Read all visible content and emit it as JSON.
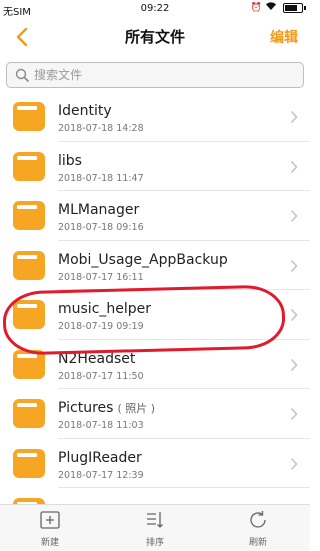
{
  "status_bar": {
    "carrier": "无SIM",
    "time": "09:22",
    "battery_label": ""
  },
  "nav": {
    "title": "所有文件",
    "edit_label": "编辑"
  },
  "search": {
    "placeholder": "搜索文件"
  },
  "files": [
    {
      "name": "Identity",
      "tag": "",
      "date": "2018-07-18 14:28"
    },
    {
      "name": "libs",
      "tag": "",
      "date": "2018-07-18 11:47"
    },
    {
      "name": "MLManager",
      "tag": "",
      "date": "2018-07-18 09:16"
    },
    {
      "name": "Mobi_Usage_AppBackup",
      "tag": "",
      "date": "2018-07-17 16:11"
    },
    {
      "name": "music_helper",
      "tag": "",
      "date": "2018-07-19 09:19"
    },
    {
      "name": "N2Headset",
      "tag": "",
      "date": "2018-07-17 11:50"
    },
    {
      "name": "Pictures",
      "tag": "( 照片 )",
      "date": "2018-07-18 11:03"
    },
    {
      "name": "PlugIReader",
      "tag": "",
      "date": "2018-07-17 12:39"
    },
    {
      "name": "",
      "tag": "",
      "date": ""
    }
  ],
  "bottom_bar": {
    "new_label": "新建",
    "sort_label": "排序",
    "refresh_label": "刷新"
  },
  "colors": {
    "accent": "#f39a1b",
    "folder": "#f7a623",
    "highlight": "#e01c2c"
  }
}
